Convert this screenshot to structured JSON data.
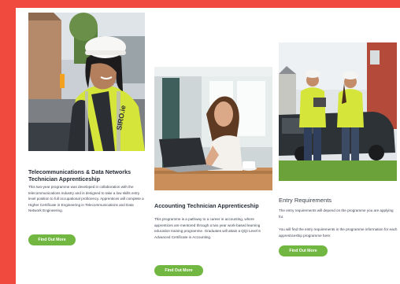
{
  "cards": [
    {
      "title": "Telecommunications & Data Networks Technician Apprenticeship",
      "body": "This two-year programme was developed in collaboration with the telecommunications industry and is designed to take a low skills entry level position to full occupational proficiency. Apprentices will complete a Higher Certificate in Engineering in Telecommunications and Data Network Engineering.",
      "button": "Find Out More",
      "image_alt": "Female technician in hard hat and hi-vis vest",
      "vest_text": "SIRO.ie"
    },
    {
      "title": "Accounting Technician Apprenticeship",
      "body": "This programme is a pathway to a career in accounting, where apprentices are mentored through a two year work-based learning education training programme. Graduates will attain a QQI Level 6 Advanced Certificate in Accounting.",
      "button": "Find Out More",
      "image_alt": "Woman working on laptop at desk"
    },
    {
      "title": "Entry Requirements",
      "body_lines": [
        "The entry requirements will depend on the programme you are applying for.",
        "You will find the entry requirements in the programme information for each apprenticeship programme here:"
      ],
      "button": "Find Out More",
      "image_alt": "Two technicians in hi-vis vests beside a van"
    }
  ],
  "colors": {
    "background": "#ef4a3d",
    "button": "#72b742",
    "title": "#2a2f3a",
    "hivis": "#d6e53a"
  }
}
